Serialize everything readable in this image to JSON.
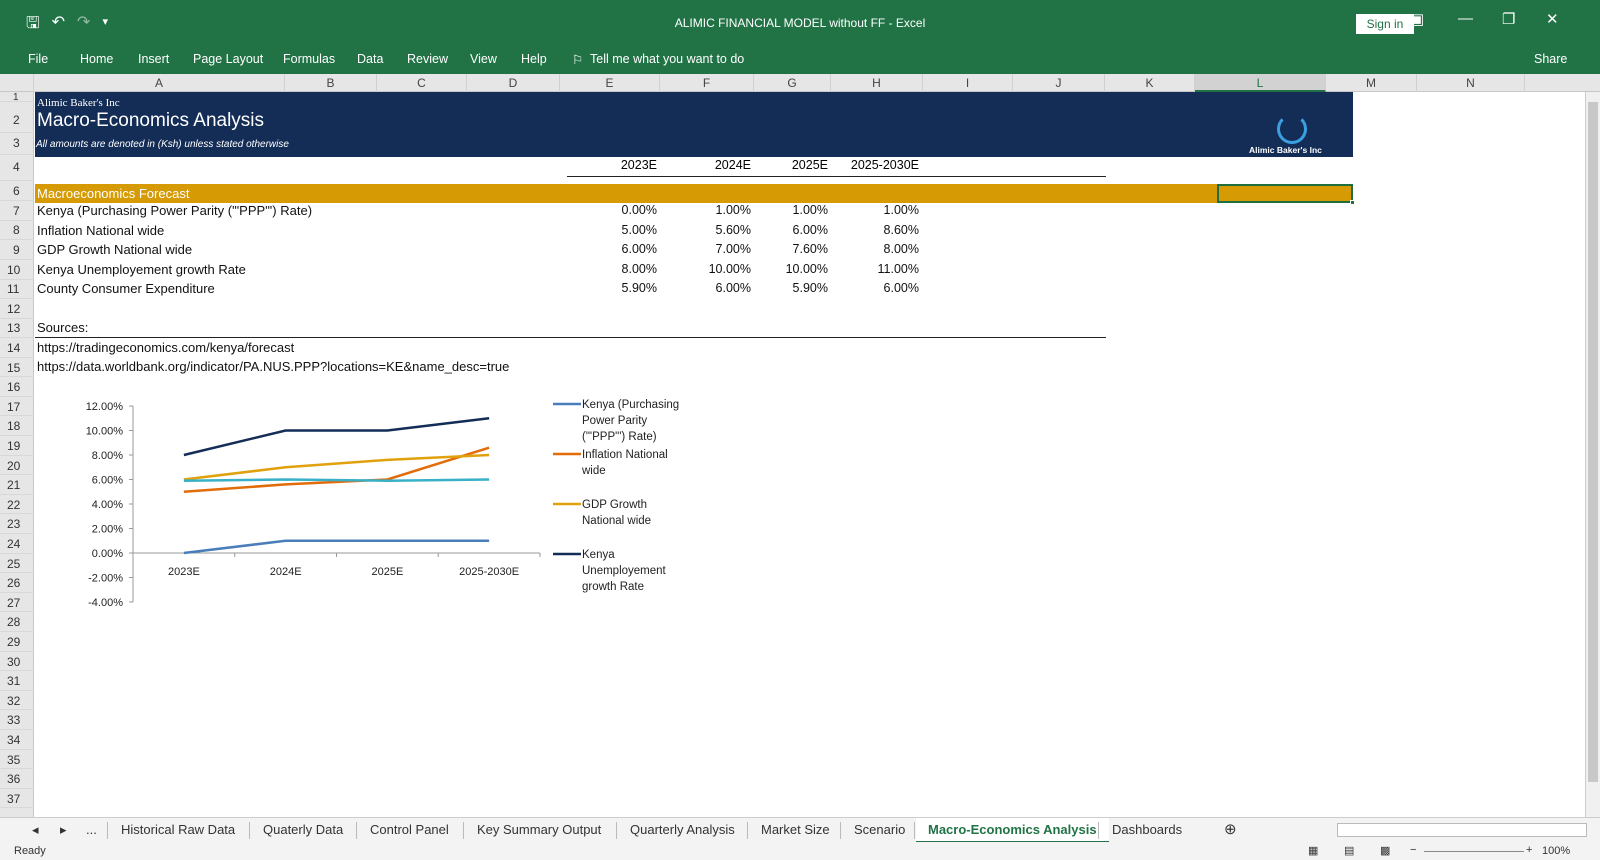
{
  "window": {
    "title": "ALIMIC FINANCIAL MODEL without FF  -  Excel",
    "sign_in": "Sign in",
    "share": "Share"
  },
  "ribbon": {
    "tabs": [
      "File",
      "Home",
      "Insert",
      "Page Layout",
      "Formulas",
      "Data",
      "Review",
      "View",
      "Help"
    ],
    "tell_me": "Tell me what you want to do"
  },
  "columns": [
    "A",
    "B",
    "C",
    "D",
    "E",
    "F",
    "G",
    "H",
    "I",
    "J",
    "K",
    "L",
    "M",
    "N"
  ],
  "rows": [
    "1",
    "2",
    "3",
    "4",
    "6",
    "7",
    "8",
    "9",
    "10",
    "11",
    "12",
    "13",
    "14",
    "15",
    "16",
    "17",
    "18",
    "19",
    "20",
    "21",
    "22",
    "23",
    "24",
    "25",
    "26",
    "27",
    "28",
    "29",
    "30",
    "31",
    "32",
    "33",
    "34",
    "35",
    "36",
    "37"
  ],
  "sheet": {
    "company": "Alimic Baker's Inc",
    "title": "Macro-Economics Analysis",
    "note": "All amounts are denoted in (Ksh) unless stated otherwise",
    "logo_text": "Alimic Baker's Inc",
    "years": [
      "2023E",
      "2024E",
      "2025E",
      "2025-2030E"
    ],
    "section": "Macroeconomics Forecast",
    "metrics": [
      {
        "label": "Kenya (Purchasing Power Parity (\"'PPP\"') Rate)",
        "values": [
          "0.00%",
          "1.00%",
          "1.00%",
          "1.00%"
        ]
      },
      {
        "label": "Inflation National wide",
        "values": [
          "5.00%",
          "5.60%",
          "6.00%",
          "8.60%"
        ]
      },
      {
        "label": "GDP Growth National wide",
        "values": [
          "6.00%",
          "7.00%",
          "7.60%",
          "8.00%"
        ]
      },
      {
        "label": "Kenya Unemployement growth Rate",
        "values": [
          "8.00%",
          "10.00%",
          "10.00%",
          "11.00%"
        ]
      },
      {
        "label": "County Consumer Expenditure",
        "values": [
          "5.90%",
          "6.00%",
          "5.90%",
          "6.00%"
        ]
      }
    ],
    "sources_label": "Sources:",
    "source_1": "https://tradingeconomics.com/kenya/forecast",
    "source_2": "https://data.worldbank.org/indicator/PA.NUS.PPP?locations=KE&name_desc=true"
  },
  "chart_data": {
    "type": "line",
    "categories": [
      "2023E",
      "2024E",
      "2025E",
      "2025-2030E"
    ],
    "ylim": [
      -4,
      12
    ],
    "y_ticks": [
      "12.00%",
      "10.00%",
      "8.00%",
      "6.00%",
      "4.00%",
      "2.00%",
      "0.00%",
      "-2.00%",
      "-4.00%"
    ],
    "legend_position": "right",
    "series": [
      {
        "name": "Kenya (Purchasing Power Parity (\"'PPP\"') Rate)",
        "legend_lines": [
          "Kenya (Purchasing",
          "Power Parity",
          "(\"'PPP\"') Rate)"
        ],
        "color": "#4a7ebb",
        "values": [
          0,
          1,
          1,
          1
        ]
      },
      {
        "name": "Inflation National wide",
        "legend_lines": [
          "Inflation National",
          "wide"
        ],
        "color": "#e36c0a",
        "values": [
          5,
          5.6,
          6,
          8.6
        ]
      },
      {
        "name": "GDP Growth National wide",
        "legend_lines": [
          "GDP Growth",
          "National wide"
        ],
        "color": "#e0a10d",
        "values": [
          6,
          7,
          7.6,
          8
        ]
      },
      {
        "name": "Kenya Unemployement growth Rate",
        "legend_lines": [
          "Kenya",
          "Unemployement",
          "growth Rate"
        ],
        "color": "#132d57",
        "values": [
          8,
          10,
          10,
          11
        ]
      },
      {
        "name": "County Consumer Expenditure",
        "color": "#38b0c8",
        "values": [
          5.9,
          6,
          5.9,
          6
        ]
      }
    ]
  },
  "sheet_tabs": [
    "...",
    "Historical Raw Data",
    "Quaterly Data",
    "Control Panel",
    "Key Summary Output",
    "Quarterly Analysis",
    "Market Size",
    "Scenario",
    "Macro-Economics Analysis",
    "Dashboards"
  ],
  "active_tab": "Macro-Economics Analysis",
  "status": {
    "ready": "Ready",
    "zoom": "100%"
  }
}
